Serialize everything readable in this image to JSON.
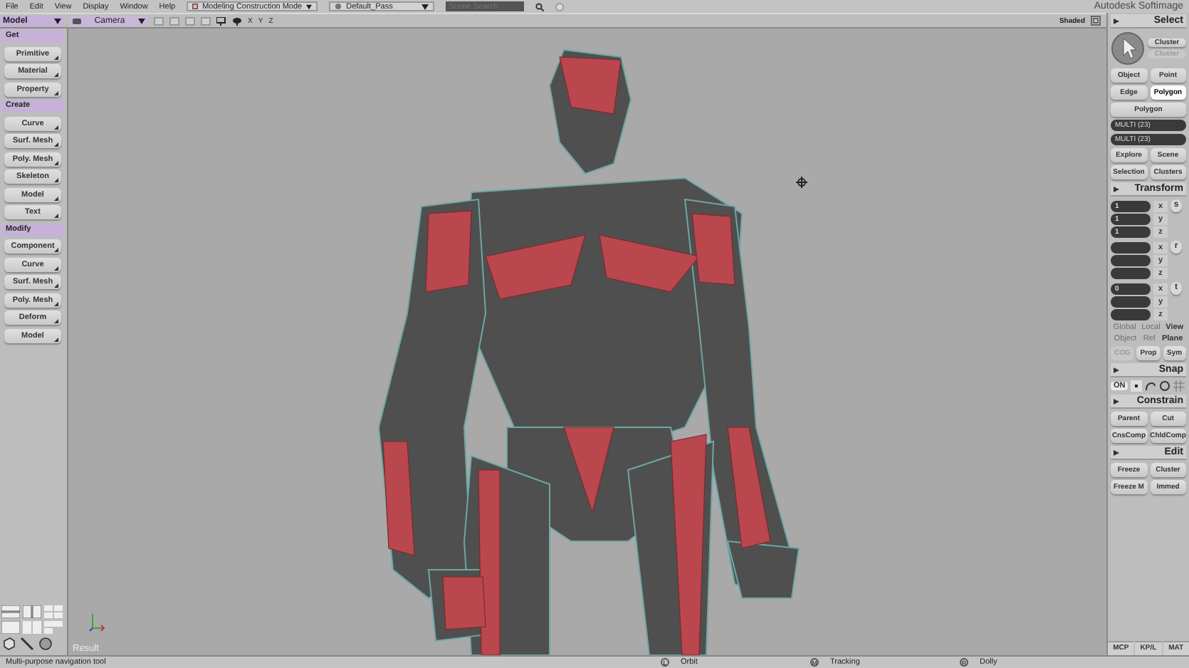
{
  "menu_bar": {
    "items": [
      "File",
      "Edit",
      "View",
      "Display",
      "Window",
      "Help"
    ],
    "mode": "Modeling Construction Mode",
    "pass": "Default_Pass",
    "search": {
      "placeholder": "Scene Search"
    },
    "app_title": "Autodesk Softimage"
  },
  "toolbar": {
    "module": "Model",
    "camera": "Camera",
    "axes": [
      "X",
      "Y",
      "Z"
    ],
    "display_mode": "Shaded"
  },
  "left_panel": {
    "sections": [
      {
        "title": "Get",
        "buttons": [
          "Primitive",
          "Material",
          "Property"
        ]
      },
      {
        "title": "Create",
        "buttons": [
          "Curve",
          "Surf. Mesh",
          "Poly. Mesh",
          "Skeleton",
          "Model",
          "Text"
        ]
      },
      {
        "title": "Modify",
        "buttons": [
          "Component",
          "Curve",
          "Surf. Mesh",
          "Poly. Mesh",
          "Deform",
          "Model"
        ]
      }
    ]
  },
  "viewport": {
    "label": "Result"
  },
  "right_panel": {
    "select": {
      "title": "Select",
      "cluster_buttons": [
        {
          "label": "Cluster",
          "disabled": false
        },
        {
          "label": "Cluster",
          "disabled": true
        }
      ],
      "filters": [
        {
          "label": "Object",
          "selected": false
        },
        {
          "label": "Point",
          "selected": false
        },
        {
          "label": "Edge",
          "selected": false
        },
        {
          "label": "Polygon",
          "selected": true
        }
      ],
      "filter_menu": "Polygon",
      "fields": [
        "MULTI (23)",
        "MULTI (23)"
      ],
      "explore_buttons": [
        "Explore",
        "Scene",
        "Selection",
        "Clusters"
      ]
    },
    "transform": {
      "title": "Transform",
      "groups": [
        {
          "tool": "s",
          "fields": [
            {
              "axis": "x",
              "value": "1"
            },
            {
              "axis": "y",
              "value": "1"
            },
            {
              "axis": "z",
              "value": "1"
            }
          ]
        },
        {
          "tool": "r",
          "fields": [
            {
              "axis": "x"
            },
            {
              "axis": "y"
            },
            {
              "axis": "z"
            }
          ]
        },
        {
          "tool": "t",
          "fields": [
            {
              "axis": "x",
              "value": "0"
            },
            {
              "axis": "y"
            },
            {
              "axis": "z"
            }
          ]
        }
      ],
      "reference_rows": [
        [
          {
            "label": "Global",
            "disabled": true
          },
          {
            "label": "Local",
            "disabled": true
          },
          {
            "label": "View",
            "disabled": false
          }
        ],
        [
          {
            "label": "Object",
            "disabled": true
          },
          {
            "label": "Ref",
            "disabled": true
          },
          {
            "label": "Plane",
            "disabled": false
          }
        ]
      ],
      "options": [
        {
          "label": "COG",
          "disabled": true
        },
        {
          "label": "Prop",
          "disabled": false
        },
        {
          "label": "Sym",
          "disabled": false
        }
      ]
    },
    "snap": {
      "title": "Snap",
      "toggle": "ON"
    },
    "constrain": {
      "title": "Constrain",
      "buttons": [
        "Parent",
        "Cut",
        "CnsComp",
        "ChldComp"
      ]
    },
    "edit": {
      "title": "Edit",
      "buttons": [
        "Freeze",
        "Cluster",
        "Freeze M",
        "Immed"
      ]
    },
    "bottom_tabs": [
      "MCP",
      "KP/L",
      "MAT"
    ]
  },
  "status_bar": {
    "hint": "Multi-purpose navigation tool",
    "mouse_actions": [
      {
        "button": "L",
        "action": "Orbit"
      },
      {
        "button": "M",
        "action": "Tracking"
      },
      {
        "button": "R",
        "action": "Dolly"
      }
    ]
  }
}
